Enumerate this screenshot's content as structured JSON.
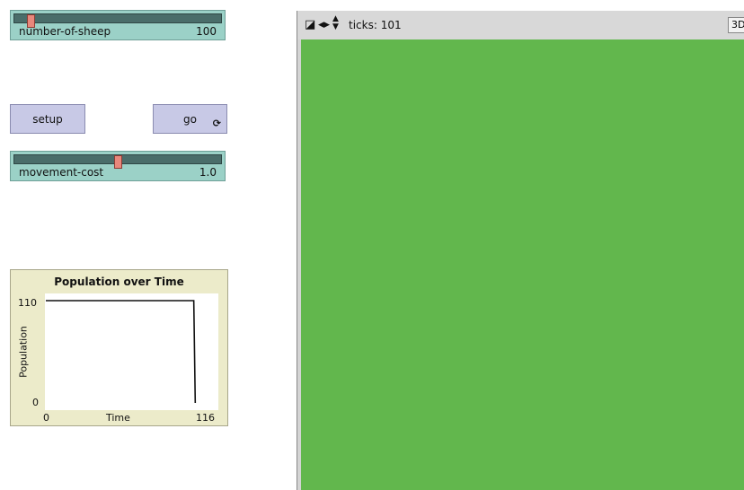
{
  "sliders": [
    {
      "name": "number-of-sheep",
      "value": "100",
      "fraction": 0.08
    },
    {
      "name": "movement-cost",
      "value": "1.0",
      "fraction": 0.5
    }
  ],
  "buttons": {
    "setup": "setup",
    "go": "go",
    "go_forever_glyph": "⟳"
  },
  "plot": {
    "title": "Population over Time",
    "ylabel": "Population",
    "xlabel": "Time",
    "y_max": "110",
    "y_min": "0",
    "x_min": "0",
    "x_max": "116"
  },
  "chart_data": {
    "type": "line",
    "title": "Population over Time",
    "xlabel": "Time",
    "ylabel": "Population",
    "xlim": [
      0,
      116
    ],
    "ylim": [
      0,
      110
    ],
    "series": [
      {
        "x": [
          0,
          100,
          101
        ],
        "y": [
          110,
          110,
          0
        ]
      }
    ]
  },
  "view": {
    "ticks_text": "ticks: 101",
    "three_d_label": "3D",
    "world_color": "#62b74d"
  }
}
